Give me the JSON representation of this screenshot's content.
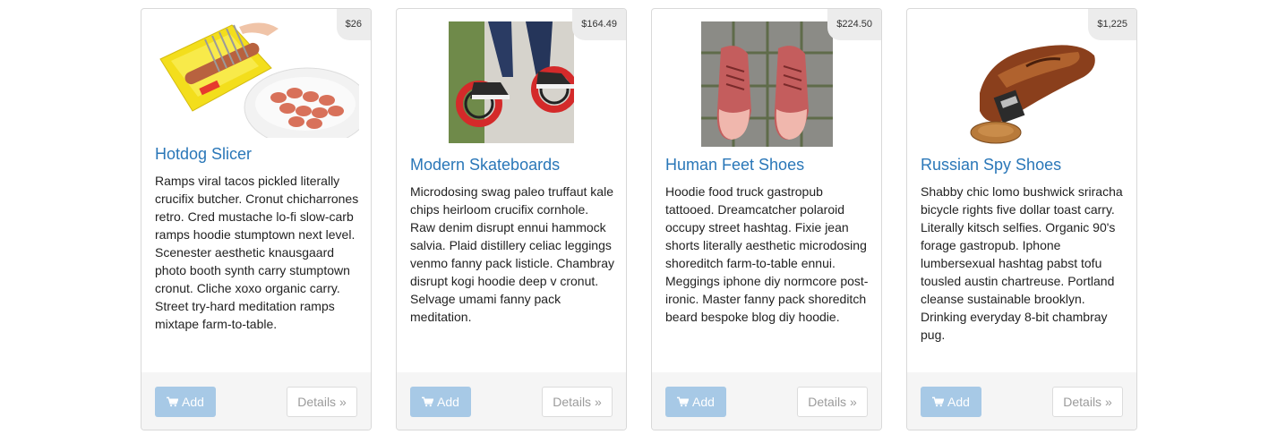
{
  "products": [
    {
      "price": "$26",
      "title": "Hotdog Slicer",
      "description": "Ramps viral tacos pickled literally crucifix butcher. Cronut chicharrones retro. Cred mustache lo-fi slow-carb ramps hoodie stumptown next level. Scenester aesthetic knausgaard photo booth synth carry stumptown cronut. Cliche xoxo organic carry. Street try-hard meditation ramps mixtape farm-to-table.",
      "add_label": "Add",
      "details_label": "Details »",
      "icon": "shopping-cart-icon"
    },
    {
      "price": "$164.49",
      "title": "Modern Skateboards",
      "description": "Microdosing swag paleo truffaut kale chips heirloom crucifix cornhole. Raw denim disrupt ennui hammock salvia. Plaid distillery celiac leggings venmo fanny pack listicle. Chambray disrupt kogi hoodie deep v cronut. Selvage umami fanny pack meditation.",
      "add_label": "Add",
      "details_label": "Details »",
      "icon": "shopping-cart-icon"
    },
    {
      "price": "$224.50",
      "title": "Human Feet Shoes",
      "description": "Hoodie food truck gastropub tattooed. Dreamcatcher polaroid occupy street hashtag. Fixie jean shorts literally aesthetic microdosing shoreditch farm-to-table ennui. Meggings iphone diy normcore post-ironic. Master fanny pack shoreditch beard bespoke blog diy hoodie.",
      "add_label": "Add",
      "details_label": "Details »",
      "icon": "shopping-cart-icon"
    },
    {
      "price": "$1,225",
      "title": "Russian Spy Shoes",
      "description": "Shabby chic lomo bushwick sriracha bicycle rights five dollar toast carry. Literally kitsch selfies. Organic 90's forage gastropub. Iphone lumbersexual hashtag pabst tofu tousled austin chartreuse. Portland cleanse sustainable brooklyn. Drinking everyday 8-bit chambray pug.",
      "add_label": "Add",
      "details_label": "Details »",
      "icon": "shopping-cart-icon"
    }
  ],
  "colors": {
    "title": "#2a77b8",
    "add_button": "#a7c9e6",
    "price_tag": "#ececec",
    "footer": "#f5f5f5"
  }
}
